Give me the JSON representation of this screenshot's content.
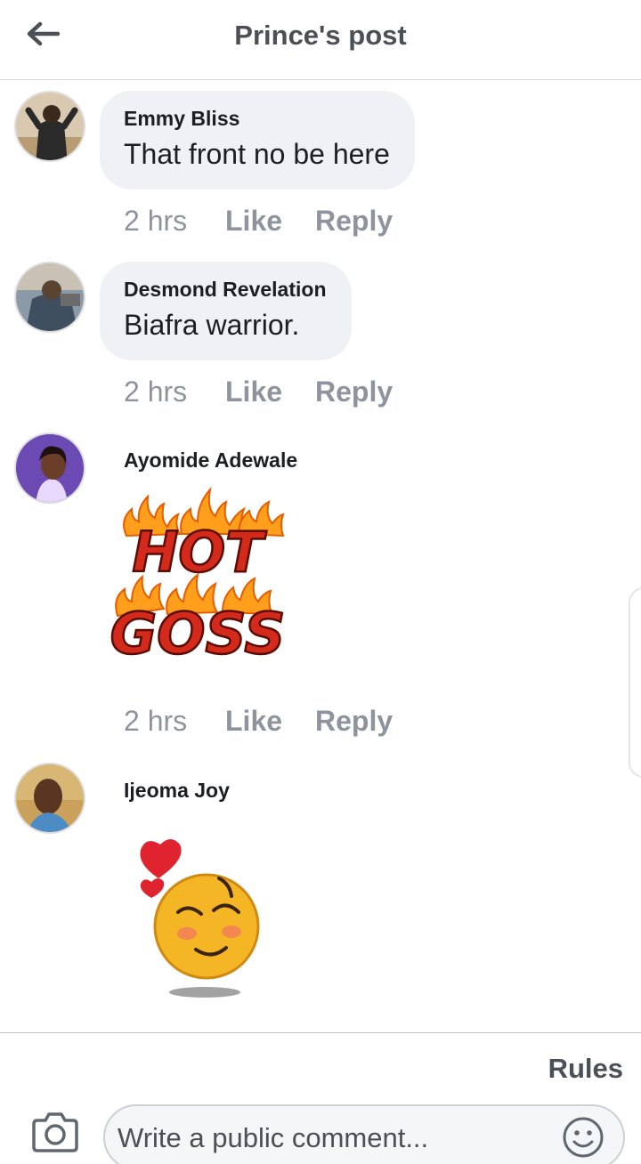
{
  "header": {
    "title": "Prince's post"
  },
  "comments": [
    {
      "author": "Emmy Bliss",
      "text": "That front no be here",
      "time": "2 hrs",
      "like": "Like",
      "reply": "Reply"
    },
    {
      "author": "Desmond Revelation",
      "text": "Biafra warrior.",
      "time": "2 hrs",
      "like": "Like",
      "reply": "Reply"
    },
    {
      "author": "Ayomide Adewale",
      "sticker": {
        "line1": "HOT",
        "line2": "GOSS"
      },
      "time": "2 hrs",
      "like": "Like",
      "reply": "Reply"
    },
    {
      "author": "Ijeoma Joy"
    }
  ],
  "footer": {
    "rules_label": "Rules",
    "comment_placeholder": "Write a public comment..."
  },
  "colors": {
    "bubble": "#f0f1f4",
    "meta_text": "#8d949e",
    "fire_red": "#d42a1c",
    "fire_orange": "#ff9f1c"
  }
}
